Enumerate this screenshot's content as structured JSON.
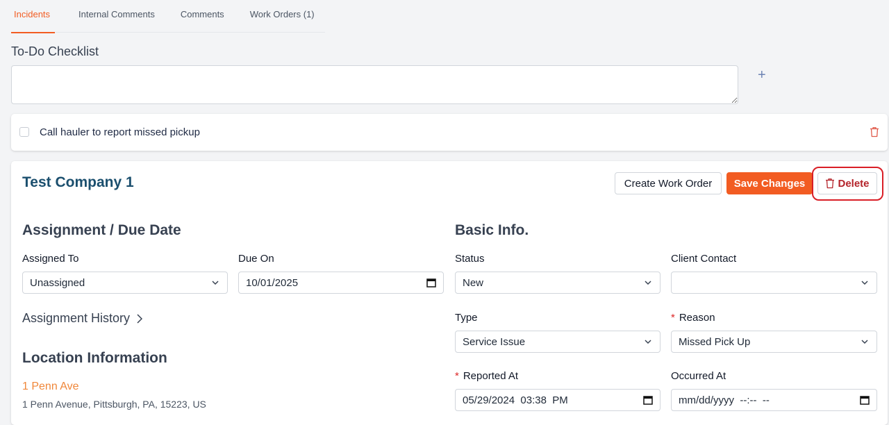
{
  "tabs": [
    {
      "label": "Incidents",
      "active": true
    },
    {
      "label": "Internal Comments",
      "active": false
    },
    {
      "label": "Comments",
      "active": false
    },
    {
      "label": "Work Orders (1)",
      "active": false
    }
  ],
  "todo": {
    "title": "To-Do Checklist",
    "input_value": "",
    "items": [
      {
        "label": "Call hauler to report missed pickup",
        "checked": false
      }
    ]
  },
  "incident": {
    "company": "Test Company 1",
    "buttons": {
      "create_work_order": "Create Work Order",
      "save_changes": "Save Changes",
      "delete": "Delete"
    },
    "assignment": {
      "title": "Assignment / Due Date",
      "assigned_to_label": "Assigned To",
      "assigned_to_value": "Unassigned",
      "due_on_label": "Due On",
      "due_on_value": "10/01/2025",
      "history_label": "Assignment History"
    },
    "location": {
      "title": "Location Information",
      "name": "1 Penn Ave",
      "address": "1 Penn Avenue, Pittsburgh, PA, 15223, US"
    },
    "basic": {
      "title": "Basic Info.",
      "status_label": "Status",
      "status_value": "New",
      "client_contact_label": "Client Contact",
      "client_contact_value": "",
      "type_label": "Type",
      "type_value": "Service Issue",
      "reason_label": "Reason",
      "reason_value": "Missed Pick Up",
      "reported_at_label": "Reported At",
      "reported_at_value": "05/29/2024  03:38  PM",
      "occurred_at_label": "Occurred At",
      "occurred_at_value": "mm/dd/yyyy  --:--  --"
    }
  },
  "colors": {
    "accent": "#f25c22",
    "company_title": "#1b4f6e",
    "location_link": "#f0873a",
    "delete_text": "#b4232a",
    "highlight": "#d91e26"
  }
}
